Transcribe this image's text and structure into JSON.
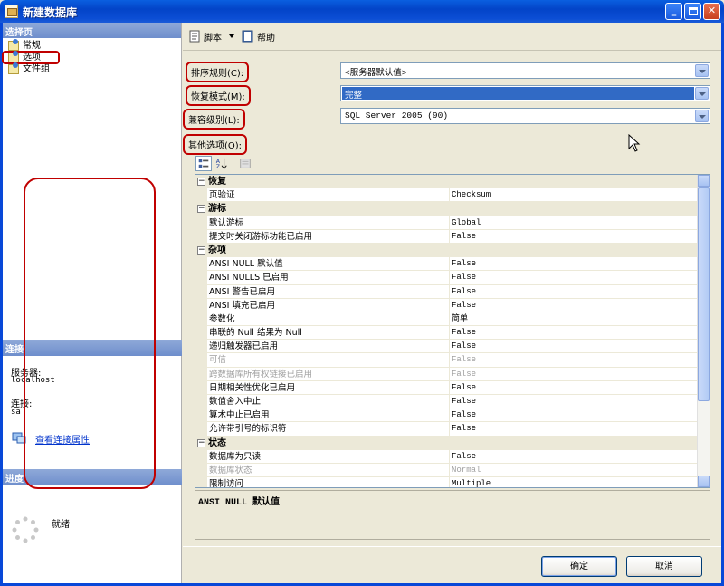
{
  "window": {
    "title": "新建数据库"
  },
  "left": {
    "pages_header": "选择页",
    "pages": [
      {
        "label": "常规"
      },
      {
        "label": "选项"
      },
      {
        "label": "文件组"
      }
    ],
    "connection_header": "连接",
    "server_label": "服务器:",
    "server_value": "localhost",
    "connection_label": "连接:",
    "connection_value": "sa",
    "view_connection_link": "查看连接属性",
    "progress_header": "进度",
    "progress_status": "就绪"
  },
  "toolbar": {
    "script_label": "脚本",
    "help_label": "帮助"
  },
  "form": {
    "collation_label": "排序规则(C):",
    "collation_value": "<服务器默认值>",
    "recovery_label": "恢复模式(M):",
    "recovery_value": "完整",
    "compat_label": "兼容级别(L):",
    "compat_value": "SQL Server 2005 (90)",
    "other_label": "其他选项(O):"
  },
  "grid": {
    "rows": [
      {
        "type": "category",
        "name": "恢复"
      },
      {
        "type": "prop",
        "name": "页验证",
        "value": "Checksum"
      },
      {
        "type": "category",
        "name": "游标"
      },
      {
        "type": "prop",
        "name": "默认游标",
        "value": "Global"
      },
      {
        "type": "prop",
        "name": "提交时关闭游标功能已启用",
        "value": "False"
      },
      {
        "type": "category",
        "name": "杂项"
      },
      {
        "type": "prop",
        "name": "ANSI NULL 默认值",
        "value": "False"
      },
      {
        "type": "prop",
        "name": "ANSI NULLS 已启用",
        "value": "False"
      },
      {
        "type": "prop",
        "name": "ANSI 警告已启用",
        "value": "False"
      },
      {
        "type": "prop",
        "name": "ANSI 填充已启用",
        "value": "False"
      },
      {
        "type": "prop",
        "name": "参数化",
        "value": "简单"
      },
      {
        "type": "prop",
        "name": "串联的 Null 结果为 Null",
        "value": "False"
      },
      {
        "type": "prop",
        "name": "递归触发器已启用",
        "value": "False"
      },
      {
        "type": "prop",
        "name": "可信",
        "value": "False",
        "disabled": true
      },
      {
        "type": "prop",
        "name": "跨数据库所有权链接已启用",
        "value": "False",
        "disabled": true
      },
      {
        "type": "prop",
        "name": "日期相关性优化已启用",
        "value": "False"
      },
      {
        "type": "prop",
        "name": "数值舍入中止",
        "value": "False"
      },
      {
        "type": "prop",
        "name": "算术中止已启用",
        "value": "False"
      },
      {
        "type": "prop",
        "name": "允许带引号的标识符",
        "value": "False"
      },
      {
        "type": "category",
        "name": "状态"
      },
      {
        "type": "prop",
        "name": "数据库为只读",
        "value": "False"
      },
      {
        "type": "prop",
        "name": "数据库状态",
        "value": "Normal",
        "disabled": true
      },
      {
        "type": "prop",
        "name": "限制访问",
        "value": "Multiple"
      }
    ],
    "description": "ANSI NULL 默认值"
  },
  "buttons": {
    "ok": "确定",
    "cancel": "取消"
  },
  "colors": {
    "titlebar": "#0A5FE0",
    "highlight_annotation": "#C00000",
    "selection": "#316AC5"
  },
  "icons": [
    "app-icon",
    "minimize-icon",
    "maximize-icon",
    "close-icon",
    "page-icon",
    "connection-properties-icon",
    "script-icon",
    "help-icon",
    "categorized-icon",
    "alphabetical-icon",
    "property-pages-icon",
    "progress-spinner-icon",
    "mouse-cursor-icon"
  ]
}
